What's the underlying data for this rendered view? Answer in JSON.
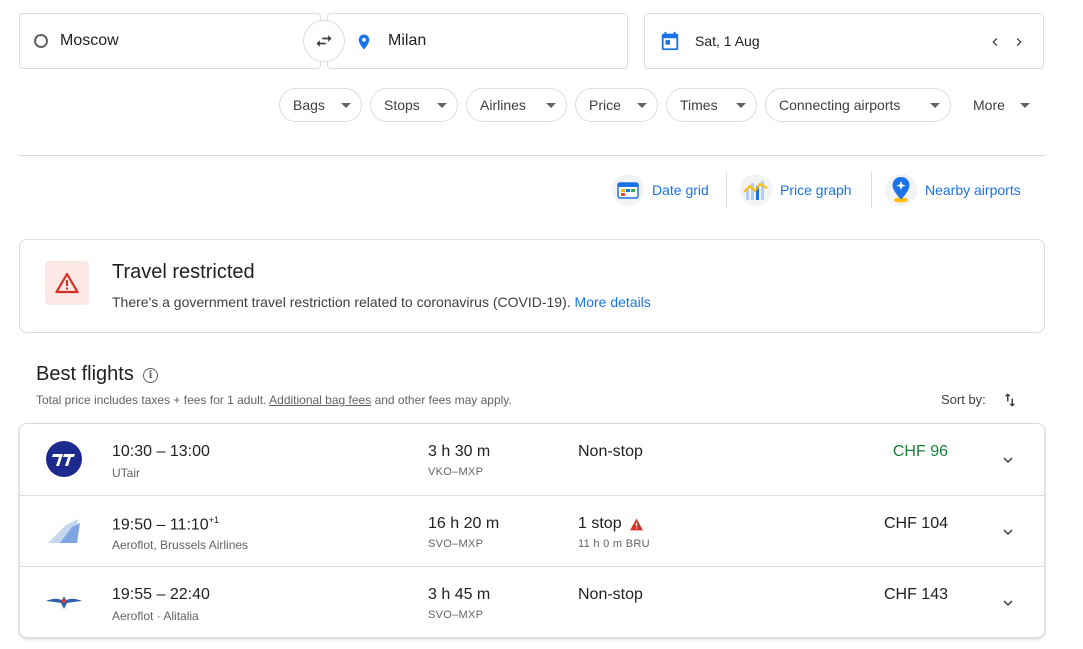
{
  "search": {
    "origin": "Moscow",
    "destination": "Milan",
    "date": "Sat, 1 Aug"
  },
  "filters": [
    "Bags",
    "Stops",
    "Airlines",
    "Price",
    "Times",
    "Connecting airports"
  ],
  "more_label": "More",
  "tools": {
    "date_grid": "Date grid",
    "price_graph": "Price graph",
    "nearby_airports": "Nearby airports"
  },
  "alert": {
    "title": "Travel restricted",
    "body": "There's a government travel restriction related to coronavirus (COVID-19).",
    "link": "More details"
  },
  "best_flights": {
    "title": "Best flights",
    "subtitle_prefix": "Total price includes taxes + fees for 1 adult.",
    "subtitle_link": "Additional bag fees",
    "subtitle_suffix": "and other fees may apply.",
    "sort_label": "Sort by:"
  },
  "flights": [
    {
      "times": "10:30 – 13:00",
      "day_offset": "",
      "airline": "UTair",
      "duration": "3 h 30 m",
      "route": "VKO–MXP",
      "stops": "Non-stop",
      "layover": "",
      "price": "CHF 96",
      "logo": "utair-logo-icon"
    },
    {
      "times": "19:50 – 11:10",
      "day_offset": "+1",
      "airline": "Aeroflot, Brussels Airlines",
      "duration": "16 h 20 m",
      "route": "SVO–MXP",
      "stops": "1 stop",
      "layover": "11 h 0 m BRU",
      "price": "CHF 104",
      "logo": "multi-airline-tail-icon"
    },
    {
      "times": "19:55 – 22:40",
      "day_offset": "",
      "airline": "Aeroflot · Alitalia",
      "duration": "3 h 45 m",
      "route": "SVO–MXP",
      "stops": "Non-stop",
      "layover": "",
      "price": "CHF 143",
      "logo": "aeroflot-logo-icon"
    }
  ],
  "colors": {
    "accent_blue": "#1a73e8",
    "cheap_price_green": "#188038",
    "alert_red": "#d93025",
    "border": "#dadce0"
  }
}
